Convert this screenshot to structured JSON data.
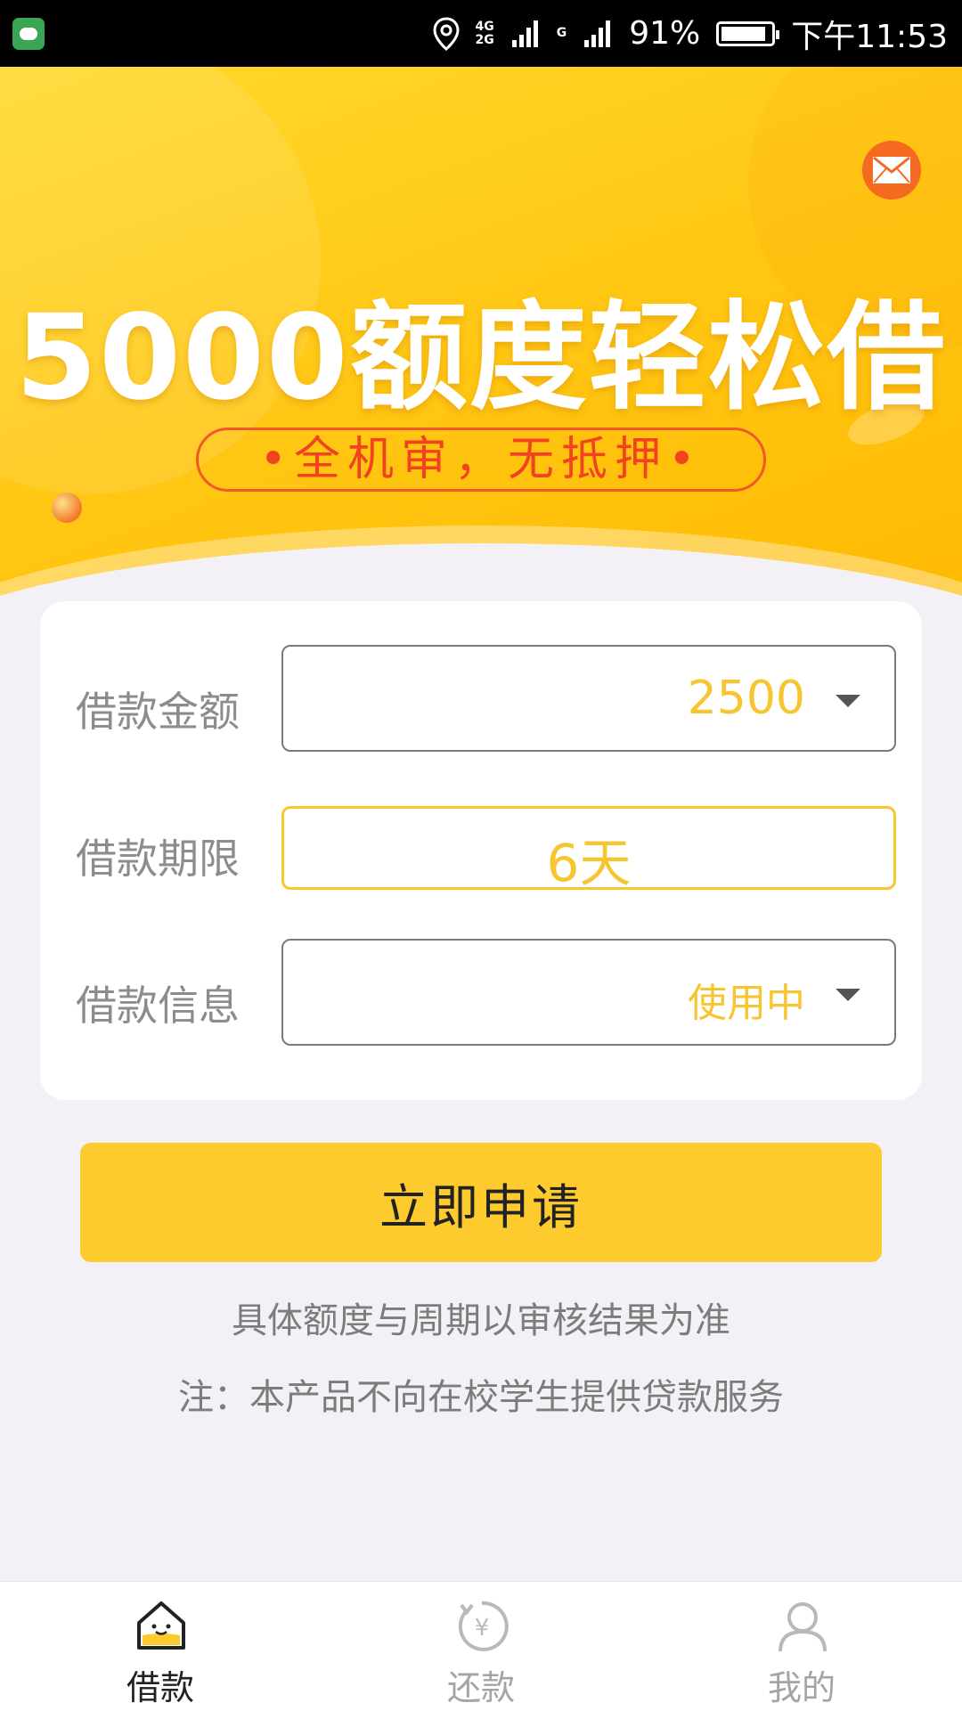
{
  "status_bar": {
    "network_top": "4G",
    "network_bottom": "2G",
    "sim2": "G",
    "battery": "91%",
    "battery_level": 0.91,
    "time": "下午11:53"
  },
  "banner": {
    "headline": "5000额度轻松借",
    "slogan": "•全机审，无抵押•",
    "mail_icon": "envelope-icon"
  },
  "form": {
    "amount": {
      "label": "借款金额",
      "value": "2500"
    },
    "term": {
      "label": "借款期限",
      "value": "6天"
    },
    "info": {
      "label": "借款信息",
      "value": "使用中"
    }
  },
  "apply_button": "立即申请",
  "notes": {
    "line1": "具体额度与周期以审核结果为准",
    "line2": "注：本产品不向在校学生提供贷款服务"
  },
  "tabs": [
    {
      "label": "借款",
      "icon": "house-icon",
      "active": true
    },
    {
      "label": "还款",
      "icon": "yuan-refresh-icon",
      "active": false
    },
    {
      "label": "我的",
      "icon": "user-icon",
      "active": false
    }
  ],
  "colors": {
    "accent": "#fecb2f",
    "value_text": "#f6c530",
    "slogan_red": "#f2431f"
  }
}
